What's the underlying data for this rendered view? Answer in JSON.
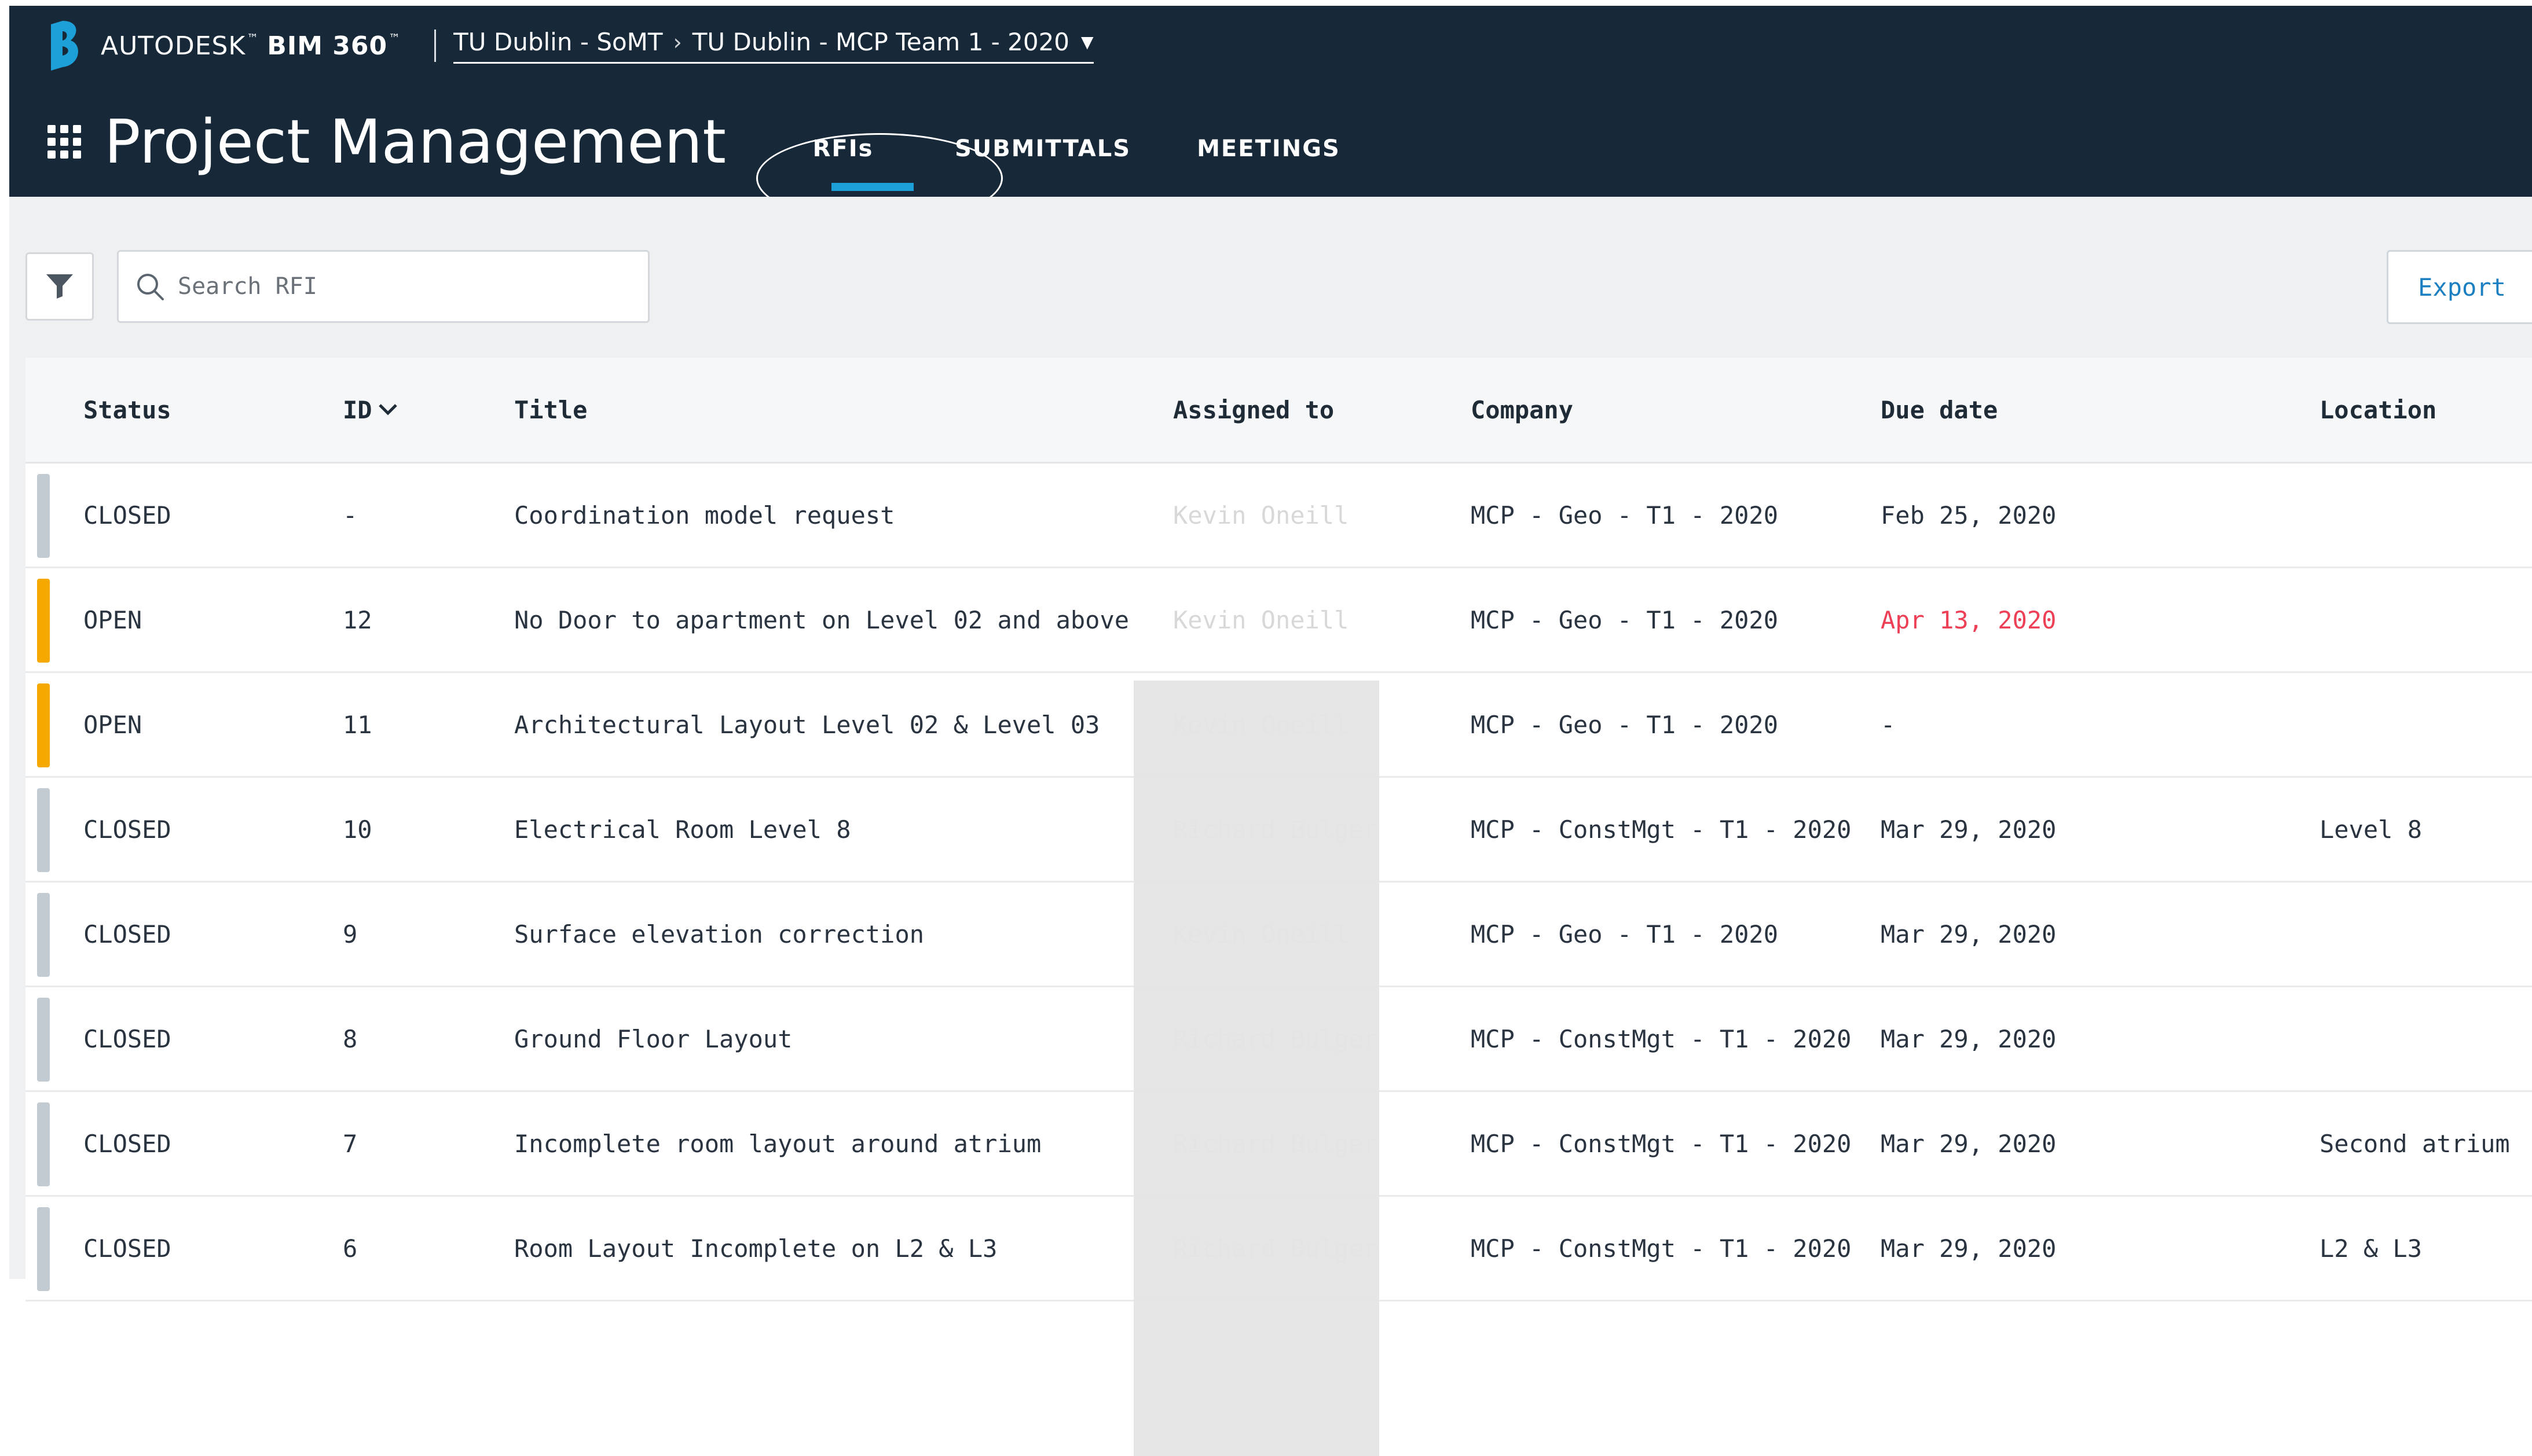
{
  "header": {
    "brand_autodesk": "AUTODESK",
    "brand_product": "BIM 360",
    "brand_tm": "™",
    "breadcrumb": {
      "account": "TU Dublin - SoMT",
      "project": "TU Dublin - MCP Team 1 - 2020"
    },
    "page_title": "Project Management",
    "tabs": [
      {
        "label": "RFIs",
        "active": true
      },
      {
        "label": "SUBMITTALS",
        "active": false
      },
      {
        "label": "MEETINGS",
        "active": false
      }
    ],
    "colors": {
      "background": "#172838",
      "active_tab_underline": "#1d9fd8"
    }
  },
  "toolbar": {
    "filter_icon": "filter-icon",
    "search_placeholder": "Search RFI",
    "search_value": "",
    "export_label": "Export"
  },
  "table": {
    "columns": {
      "status": "Status",
      "id": "ID",
      "title": "Title",
      "assigned_to": "Assigned to",
      "company": "Company",
      "due_date": "Due date",
      "location": "Location"
    },
    "sort_column": "ID",
    "status_colors": {
      "CLOSED": "#c3cbd2",
      "OPEN": "#f5a800"
    },
    "overdue_color": "#ed3f55",
    "rows": [
      {
        "status": "CLOSED",
        "id": "-",
        "title": "Coordination model request",
        "assigned_to": "Kevin Oneill",
        "company": "MCP - Geo - T1 - 2020",
        "due_date": "Feb 25, 2020",
        "overdue": false,
        "location": ""
      },
      {
        "status": "OPEN",
        "id": "12",
        "title": "No Door to apartment on Level 02 and above",
        "assigned_to": "Kevin Oneill",
        "company": "MCP - Geo - T1 - 2020",
        "due_date": "Apr 13, 2020",
        "overdue": true,
        "location": ""
      },
      {
        "status": "OPEN",
        "id": "11",
        "title": "Architectural Layout Level 02 & Level 03",
        "assigned_to": "Kevin Oneill",
        "company": "MCP - Geo - T1 - 2020",
        "due_date": "-",
        "overdue": false,
        "location": ""
      },
      {
        "status": "CLOSED",
        "id": "10",
        "title": "Electrical Room Level 8",
        "assigned_to": "Richard Bulger",
        "company": "MCP - ConstMgt - T1 - 2020",
        "due_date": "Mar 29, 2020",
        "overdue": false,
        "location": "Level 8"
      },
      {
        "status": "CLOSED",
        "id": "9",
        "title": "Surface elevation correction",
        "assigned_to": "Kevin Oneill",
        "company": "MCP - Geo - T1 - 2020",
        "due_date": "Mar 29, 2020",
        "overdue": false,
        "location": ""
      },
      {
        "status": "CLOSED",
        "id": "8",
        "title": "Ground Floor Layout",
        "assigned_to": "Richard Bulger",
        "company": "MCP - ConstMgt - T1 - 2020",
        "due_date": "Mar 29, 2020",
        "overdue": false,
        "location": ""
      },
      {
        "status": "CLOSED",
        "id": "7",
        "title": "Incomplete room layout around atrium",
        "assigned_to": "Richard Bulger",
        "company": "MCP - ConstMgt - T1 - 2020",
        "due_date": "Mar 29, 2020",
        "overdue": false,
        "location": "Second atrium"
      },
      {
        "status": "CLOSED",
        "id": "6",
        "title": "Room Layout Incomplete on L2 & L3",
        "assigned_to": "Richard Bulger",
        "company": "MCP - ConstMgt - T1 - 2020",
        "due_date": "Mar 29, 2020",
        "overdue": false,
        "location": "L2 & L3"
      }
    ]
  }
}
